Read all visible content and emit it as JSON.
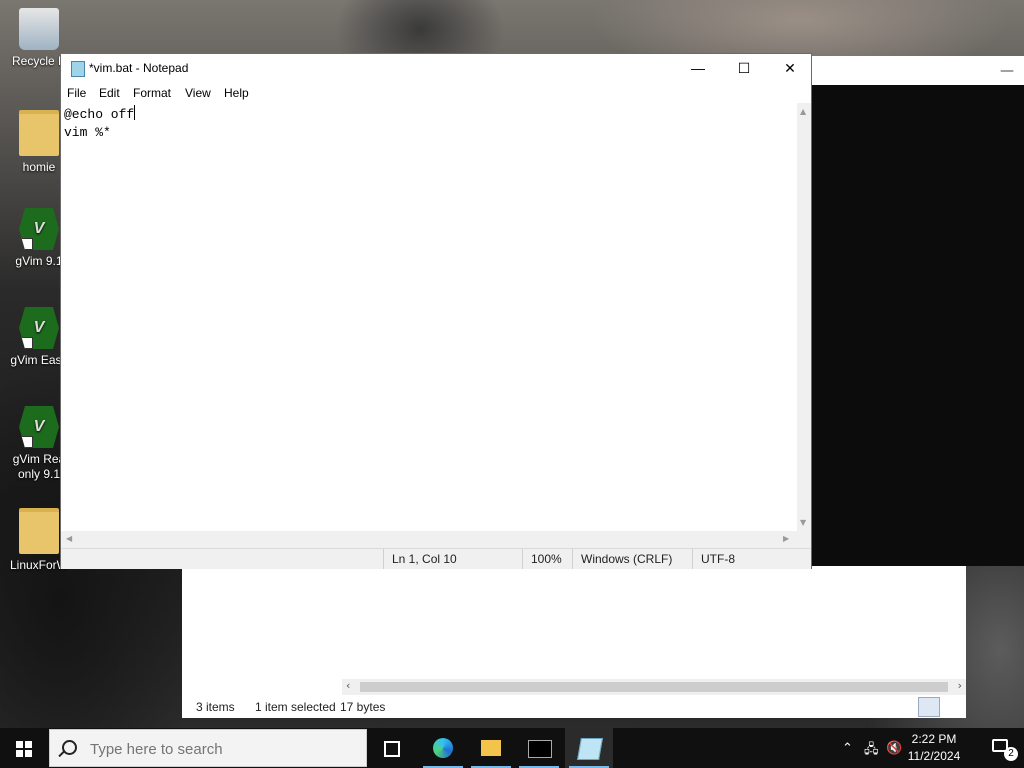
{
  "desktop": {
    "icons": [
      {
        "label": "Recycle B",
        "type": "recycle-bin"
      },
      {
        "label": "homie",
        "type": "folder"
      },
      {
        "label": "gVim 9.1",
        "type": "vim"
      },
      {
        "label": "gVim Easy",
        "type": "vim"
      },
      {
        "label": "gVim Rea only 9.1",
        "type": "vim"
      },
      {
        "label": "LinuxForW",
        "type": "folder"
      }
    ]
  },
  "notepad": {
    "title": "*vim.bat - Notepad",
    "menu": [
      "File",
      "Edit",
      "Format",
      "View",
      "Help"
    ],
    "content": [
      "@echo off",
      "vim %*"
    ],
    "status": {
      "position": "Ln 1, Col 10",
      "zoom": "100%",
      "line_ending": "Windows (CRLF)",
      "encoding": "UTF-8"
    }
  },
  "explorer": {
    "status": {
      "items": "3 items",
      "selected": "1 item selected",
      "size": "17 bytes"
    }
  },
  "taskbar": {
    "search_placeholder": "Type here to search",
    "apps": [
      "task-view",
      "edge",
      "file-explorer",
      "terminal",
      "notepad"
    ],
    "active_app": "notepad",
    "time": "2:22 PM",
    "date": "11/2/2024",
    "notification_count": "2"
  },
  "colors": {
    "taskbar": "#101010",
    "accent": "#76b9ed",
    "vim_green": "#1d6b1d"
  }
}
